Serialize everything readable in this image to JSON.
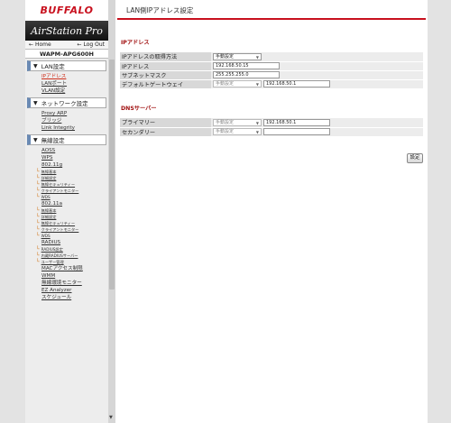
{
  "brand": "BUFFALO",
  "product": "AirStation Pro",
  "home_label": "Home",
  "logout_label": "Log Out",
  "model": "WAPM-APG600H",
  "sidebar": [
    {
      "heading": "LAN設定",
      "items": [
        {
          "label": "IPアドレス",
          "sub": false,
          "active": true
        },
        {
          "label": "LANポート",
          "sub": false
        },
        {
          "label": "VLAN設定",
          "sub": false
        }
      ]
    },
    {
      "heading": "ネットワーク設定",
      "items": [
        {
          "label": "Proxy ARP",
          "sub": false
        },
        {
          "label": "ブリッジ",
          "sub": false
        },
        {
          "label": "Link Integrity",
          "sub": false
        }
      ]
    },
    {
      "heading": "無線設定",
      "items": [
        {
          "label": "AOSS",
          "sub": false
        },
        {
          "label": "WPS",
          "sub": false
        },
        {
          "label": "802.11g",
          "sub": false
        },
        {
          "label": "無線基本",
          "sub": true
        },
        {
          "label": "詳細設定",
          "sub": true
        },
        {
          "label": "無線セキュリティー",
          "sub": true
        },
        {
          "label": "クライアントモニター",
          "sub": true
        },
        {
          "label": "WDS",
          "sub": true
        },
        {
          "label": "802.11a",
          "sub": false
        },
        {
          "label": "無線基本",
          "sub": true
        },
        {
          "label": "詳細設定",
          "sub": true
        },
        {
          "label": "無線セキュリティー",
          "sub": true
        },
        {
          "label": "クライアントモニター",
          "sub": true
        },
        {
          "label": "WDS",
          "sub": true
        },
        {
          "label": "RADIUS",
          "sub": false
        },
        {
          "label": "RADIUS設定",
          "sub": true
        },
        {
          "label": "内蔵RADIUSサーバー",
          "sub": true
        },
        {
          "label": "ユーザー管理",
          "sub": true
        },
        {
          "label": "MACアクセス制限",
          "sub": false
        },
        {
          "label": "WMM",
          "sub": false
        },
        {
          "label": "無線環境モニター",
          "sub": false
        },
        {
          "label": "EZ Analyzer",
          "sub": false
        },
        {
          "label": "スケジュール",
          "sub": false
        }
      ]
    }
  ],
  "main": {
    "title": "LAN側IPアドレス設定",
    "ip_section": "IPアドレス",
    "dns_section": "DNSサーバー",
    "rows": {
      "method": {
        "label": "IPアドレスの取得方法",
        "select": "手動設定"
      },
      "ip": {
        "label": "IPアドレス",
        "value": "192.168.50.15"
      },
      "mask": {
        "label": "サブネットマスク",
        "value": "255.255.255.0"
      },
      "gateway": {
        "label": "デフォルトゲートウェイ",
        "select": "手動設定",
        "value": "192.168.50.1"
      },
      "primary": {
        "label": "プライマリー",
        "select": "手動設定",
        "value": "192.168.50.1"
      },
      "secondary": {
        "label": "セカンダリー",
        "select": "手動設定",
        "value": ""
      }
    },
    "submit_label": "設定"
  }
}
